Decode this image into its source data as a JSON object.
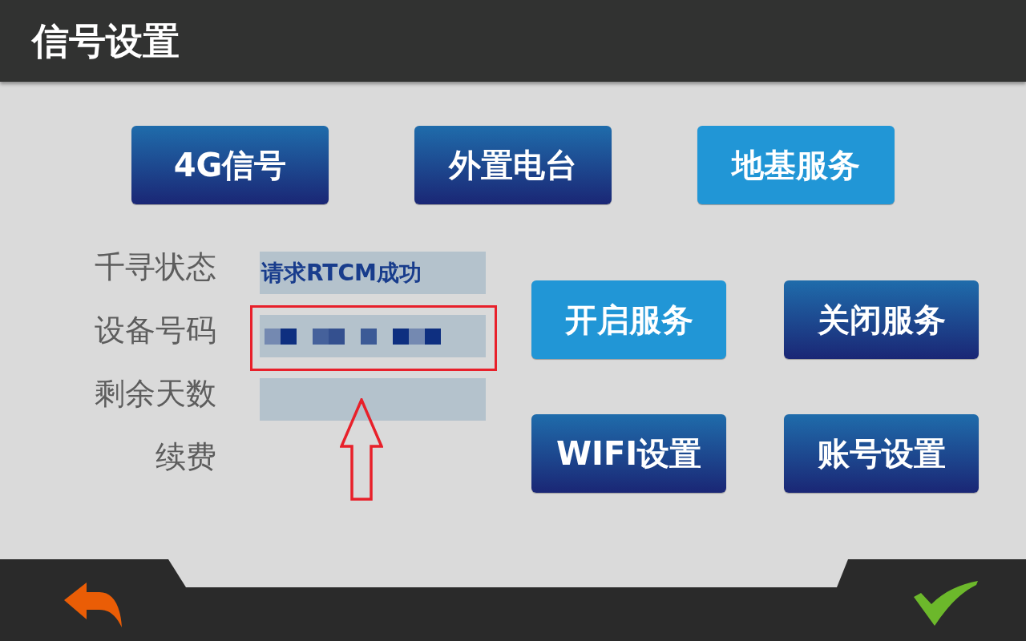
{
  "header": {
    "title": "信号设置"
  },
  "mode_tabs": [
    {
      "label": "4G信号",
      "selected": false
    },
    {
      "label": "外置电台",
      "selected": false
    },
    {
      "label": "地基服务",
      "selected": true
    }
  ],
  "fields": [
    {
      "label": "千寻状态",
      "kind": "text",
      "value": "请求RTCM成功",
      "highlighted": false
    },
    {
      "label": "设备号码",
      "kind": "masked",
      "highlighted": true
    },
    {
      "label": "剩余天数",
      "kind": "blank",
      "highlighted": false
    },
    {
      "label": "续费",
      "kind": "plain",
      "highlighted": false
    }
  ],
  "actions": [
    {
      "label": "开启服务",
      "selected": true
    },
    {
      "label": "关闭服务",
      "selected": false
    },
    {
      "label": "WIFI设置",
      "selected": false
    },
    {
      "label": "账号设置",
      "selected": false
    }
  ]
}
